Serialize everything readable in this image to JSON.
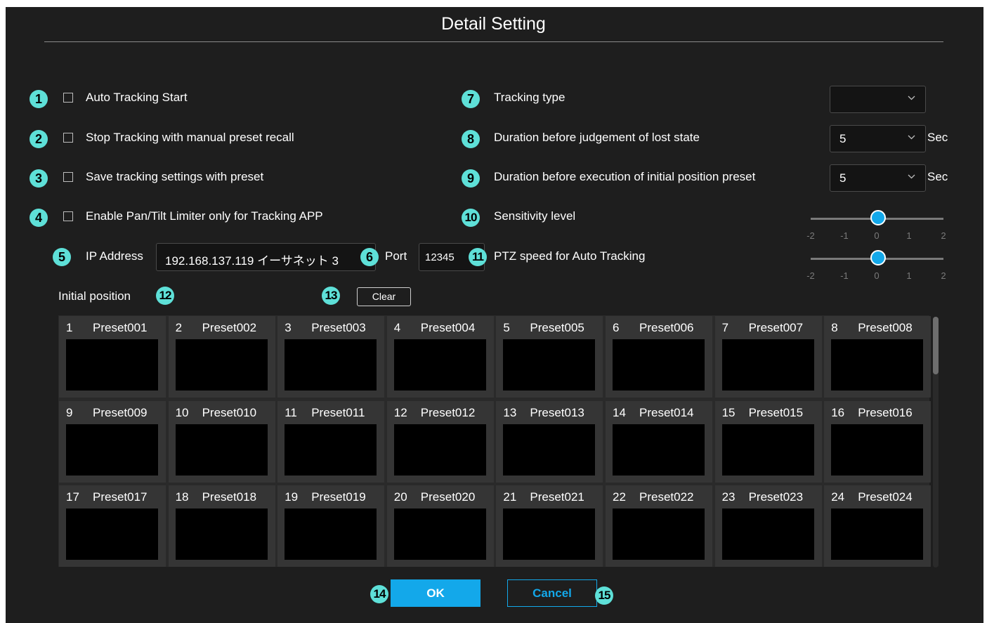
{
  "dialog": {
    "title": "Detail Setting"
  },
  "left_options": [
    {
      "badge": "1",
      "label": "Auto Tracking Start",
      "checked": false
    },
    {
      "badge": "2",
      "label": "Stop Tracking with manual preset recall",
      "checked": false
    },
    {
      "badge": "3",
      "label": "Save tracking settings with preset",
      "checked": false
    },
    {
      "badge": "4",
      "label": "Enable Pan/Tilt Limiter only for Tracking APP",
      "checked": false
    }
  ],
  "right_options": {
    "tracking_type": {
      "badge": "7",
      "label": "Tracking type",
      "value": ""
    },
    "lost_duration": {
      "badge": "8",
      "label": "Duration before judgement of lost state",
      "value": "5",
      "unit": "Sec"
    },
    "initial_duration": {
      "badge": "9",
      "label": "Duration before execution of initial position preset",
      "value": "5",
      "unit": "Sec"
    },
    "sensitivity": {
      "badge": "10",
      "label": "Sensitivity level",
      "value": 0
    },
    "ptz_speed": {
      "badge": "11",
      "label": "PTZ speed for Auto Tracking",
      "value": 0
    }
  },
  "slider_ticks": [
    "-2",
    "-1",
    "0",
    "1",
    "2"
  ],
  "network": {
    "ip_badge": "5",
    "ip_label": "IP Address",
    "ip_value": "192.168.137.119 イーサネット 3",
    "port_badge": "6",
    "port_label": "Port",
    "port_value": "12345"
  },
  "initial_position": {
    "label": "Initial position",
    "badge": "12",
    "clear_badge": "13",
    "clear_label": "Clear"
  },
  "presets": [
    {
      "num": "1",
      "name": "Preset001"
    },
    {
      "num": "2",
      "name": "Preset002"
    },
    {
      "num": "3",
      "name": "Preset003"
    },
    {
      "num": "4",
      "name": "Preset004"
    },
    {
      "num": "5",
      "name": "Preset005"
    },
    {
      "num": "6",
      "name": "Preset006"
    },
    {
      "num": "7",
      "name": "Preset007"
    },
    {
      "num": "8",
      "name": "Preset008"
    },
    {
      "num": "9",
      "name": "Preset009"
    },
    {
      "num": "10",
      "name": "Preset010"
    },
    {
      "num": "11",
      "name": "Preset011"
    },
    {
      "num": "12",
      "name": "Preset012"
    },
    {
      "num": "13",
      "name": "Preset013"
    },
    {
      "num": "14",
      "name": "Preset014"
    },
    {
      "num": "15",
      "name": "Preset015"
    },
    {
      "num": "16",
      "name": "Preset016"
    },
    {
      "num": "17",
      "name": "Preset017"
    },
    {
      "num": "18",
      "name": "Preset018"
    },
    {
      "num": "19",
      "name": "Preset019"
    },
    {
      "num": "20",
      "name": "Preset020"
    },
    {
      "num": "21",
      "name": "Preset021"
    },
    {
      "num": "22",
      "name": "Preset022"
    },
    {
      "num": "23",
      "name": "Preset023"
    },
    {
      "num": "24",
      "name": "Preset024"
    }
  ],
  "footer": {
    "ok_badge": "14",
    "ok_label": "OK",
    "cancel_badge": "15",
    "cancel_label": "Cancel"
  },
  "colors": {
    "background": "#1e1e1e",
    "accent": "#13a8ea",
    "badge": "#5ee0d8"
  }
}
